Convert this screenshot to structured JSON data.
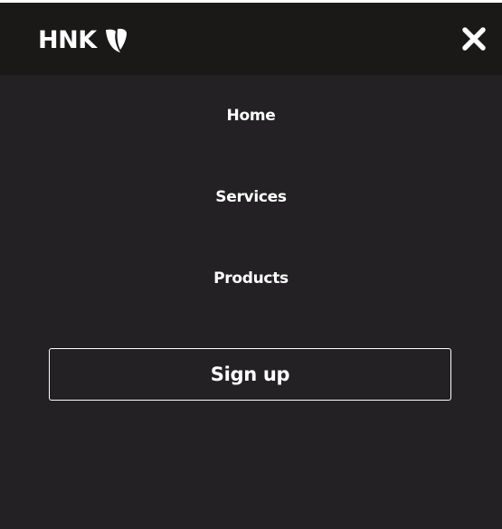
{
  "header": {
    "logo_text": "HNK",
    "logo_icon": "typo3-icon",
    "close_icon": "close-icon",
    "close_label": "Close menu"
  },
  "nav": {
    "items": [
      {
        "label": "Home"
      },
      {
        "label": "Services"
      },
      {
        "label": "Products"
      }
    ]
  },
  "cta": {
    "signup_label": "Sign up"
  },
  "colors": {
    "header_bg": "#1a1918",
    "menu_bg": "#232123",
    "text": "#ffffff"
  }
}
